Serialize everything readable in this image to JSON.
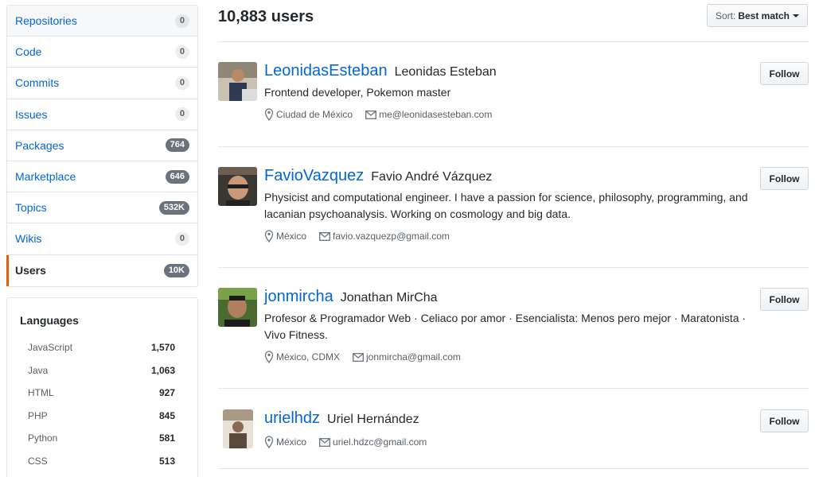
{
  "nav": [
    {
      "label": "Repositories",
      "count": "0"
    },
    {
      "label": "Code",
      "count": "0"
    },
    {
      "label": "Commits",
      "count": "0"
    },
    {
      "label": "Issues",
      "count": "0"
    },
    {
      "label": "Packages",
      "count": "764"
    },
    {
      "label": "Marketplace",
      "count": "646"
    },
    {
      "label": "Topics",
      "count": "532K"
    },
    {
      "label": "Wikis",
      "count": "0"
    },
    {
      "label": "Users",
      "count": "10K"
    }
  ],
  "languages": {
    "title": "Languages",
    "items": [
      {
        "name": "JavaScript",
        "count": "1,570"
      },
      {
        "name": "Java",
        "count": "1,063"
      },
      {
        "name": "HTML",
        "count": "927"
      },
      {
        "name": "PHP",
        "count": "845"
      },
      {
        "name": "Python",
        "count": "581"
      },
      {
        "name": "CSS",
        "count": "513"
      }
    ]
  },
  "header": {
    "title": "10,883 users",
    "sort_prefix": "Sort:",
    "sort_value": "Best match"
  },
  "follow_label": "Follow",
  "users": [
    {
      "login": "LeonidasEsteban",
      "name": "Leonidas Esteban",
      "bio": "Frontend developer, Pokemon master",
      "location": "Ciudad de México",
      "email": "me@leonidasesteban.com"
    },
    {
      "login": "FavioVazquez",
      "name": "Favio André Vázquez",
      "bio": "Physicist and computational engineer. I have a passion for science, philosophy, programming, and lacanian psychoanalysis. Working on cosmology and big data.",
      "location": "México",
      "email": "favio.vazquezp@gmail.com"
    },
    {
      "login": "jonmircha",
      "name": "Jonathan MirCha",
      "bio": "Profesor & Programador Web · Celiaco por amor · Esencialista: Menos pero mejor · Maratonista · Vivo Fitness.",
      "location": "México, CDMX",
      "email": "jonmircha@gmail.com"
    },
    {
      "login": "urielhdz",
      "name": "Uriel Hernández",
      "bio": "",
      "location": "México",
      "email": "uriel.hdzc@gmail.com"
    }
  ],
  "colors": {
    "link": "#0366d6",
    "selected_accent": "#e36209",
    "border": "#e1e4e8"
  }
}
